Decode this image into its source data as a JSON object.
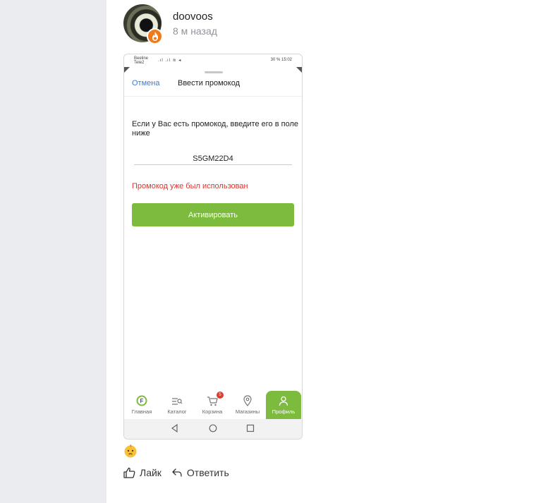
{
  "post": {
    "username": "doovoos",
    "timestamp": "8 м назад"
  },
  "screenshot": {
    "status_bar": {
      "carrier_line1": "Beeline",
      "carrier_line2": "Tele2",
      "right": "30 % 15:02"
    },
    "header": {
      "cancel": "Отмена",
      "title": "Ввести промокод"
    },
    "instruction": "Если у Вас есть промокод, введите его в поле ниже",
    "promo_value": "S5GM22D4",
    "error": "Промокод уже был использован",
    "activate_label": "Активировать",
    "tabs": [
      {
        "label": "Главная",
        "icon": "home-logo-icon"
      },
      {
        "label": "Каталог",
        "icon": "catalog-search-icon"
      },
      {
        "label": "Корзина",
        "icon": "cart-icon",
        "badge": "5"
      },
      {
        "label": "Магазины",
        "icon": "location-pin-icon"
      },
      {
        "label": "Профиль",
        "icon": "user-icon",
        "active": true
      }
    ],
    "colors": {
      "accent_green": "#7cbb3d",
      "link_blue": "#3b7bd6",
      "error_red": "#d8362f"
    }
  },
  "reaction": "worried-face-emoji",
  "actions": {
    "like": "Лайк",
    "reply": "Ответить"
  }
}
